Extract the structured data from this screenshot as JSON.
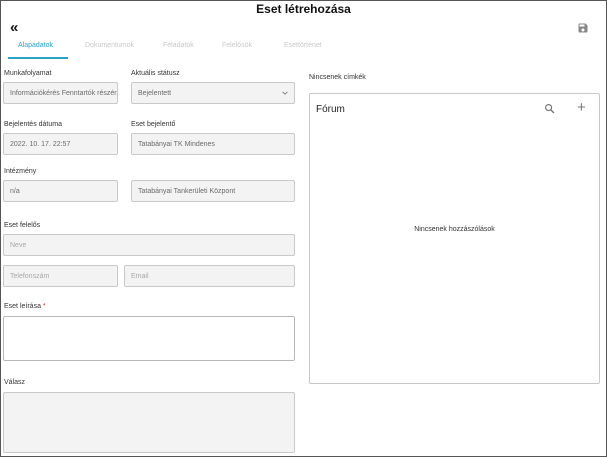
{
  "header": {
    "title": "Eset létrehozása",
    "back_icon": "«",
    "save_icon": "save-icon"
  },
  "tabs": [
    {
      "label": "Alapadatok",
      "active": true
    },
    {
      "label": "Dokumentumok",
      "active": false
    },
    {
      "label": "Feladatok",
      "active": false
    },
    {
      "label": "Felelősök",
      "active": false
    },
    {
      "label": "Esettörténet",
      "active": false
    }
  ],
  "form": {
    "workflow": {
      "label": "Munkafolyamat",
      "value": "Információkérés Fenntartók részére"
    },
    "status": {
      "label": "Aktuális státusz",
      "value": "Bejelentett"
    },
    "report_date": {
      "label": "Bejelentés dátuma",
      "value": "2022. 10. 17. 22:57"
    },
    "reporter": {
      "label": "Eset bejelentő",
      "value": "Tatabányai TK Mindenes"
    },
    "institution": {
      "label": "Intézmény",
      "value": "n/a",
      "value2": "Tatabányai Tankerületi Központ"
    },
    "responsible": {
      "label": "Eset felelős",
      "name_placeholder": "Neve",
      "phone_placeholder": "Telefonszám",
      "email_placeholder": "Email"
    },
    "description": {
      "label": "Eset leírása",
      "required_mark": "*",
      "value": ""
    },
    "answer": {
      "label": "Válasz",
      "value": ""
    }
  },
  "tags": {
    "label": "Nincsenek címkék"
  },
  "forum": {
    "title": "Fórum",
    "search_icon": "search-icon",
    "add_icon": "+",
    "empty_text": "Nincsenek hozzászólások"
  },
  "colors": {
    "accent": "#2aa3c9",
    "required": "#d32f2f",
    "field_bg": "#f3f3f3",
    "field_border": "#c9c9c9"
  }
}
